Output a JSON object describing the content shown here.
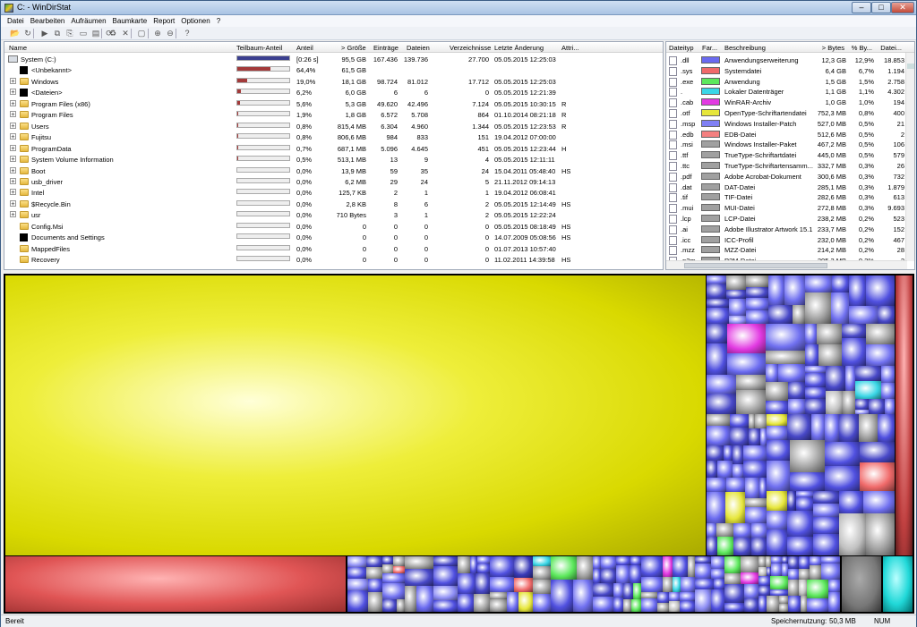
{
  "window": {
    "title": "C: - WinDirStat",
    "min": "–",
    "max": "□",
    "close": "✕"
  },
  "menu": [
    "Datei",
    "Bearbeiten",
    "Aufräumen",
    "Baumkarte",
    "Report",
    "Optionen",
    "?"
  ],
  "toolbar": [
    {
      "icon": "open-folder-icon",
      "glyph": "📂"
    },
    {
      "icon": "refresh-icon",
      "glyph": "↻"
    },
    {
      "icon": "play-icon",
      "glyph": "▶"
    },
    {
      "icon": "copy-icon",
      "glyph": "⧉"
    },
    {
      "icon": "copy-path-icon",
      "glyph": "⎘"
    },
    {
      "icon": "explorer-icon",
      "glyph": "▭"
    },
    {
      "icon": "prompt-icon",
      "glyph": "▤"
    },
    {
      "icon": "refresh-selected-icon",
      "glyph": "⟳"
    },
    {
      "icon": "recycle-icon",
      "glyph": "♻"
    },
    {
      "icon": "delete-icon",
      "glyph": "✕"
    },
    {
      "icon": "properties-icon",
      "glyph": "▢"
    },
    {
      "icon": "zoom-in-icon",
      "glyph": "⊕"
    },
    {
      "icon": "zoom-out-icon",
      "glyph": "⊖"
    },
    {
      "icon": "help-icon",
      "glyph": "?"
    }
  ],
  "tree": {
    "columns": [
      "Name",
      "Teilbaum-Anteil",
      "Anteil",
      "> Größe",
      "Einträge",
      "Dateien",
      "Verzeichnisse",
      "Letzte Änderung",
      "Attri..."
    ],
    "rows": [
      {
        "name": "System (C:)",
        "bar_text": "",
        "share": "[0:26 s]",
        "size": "95,5 GB",
        "entries": "167.436",
        "files": "139.736",
        "dirs": "27.700",
        "modified": "05.05.2015 12:25:03",
        "attr": "",
        "fill": 1.0,
        "root": true,
        "icon": "drive"
      },
      {
        "name": "<Unbekannt>",
        "share": "64,4%",
        "size": "61,5 GB",
        "entries": "",
        "files": "",
        "dirs": "",
        "modified": "",
        "attr": "",
        "fill": 0.644,
        "icon": "black"
      },
      {
        "name": "Windows",
        "share": "19,0%",
        "size": "18,1 GB",
        "entries": "98.724",
        "files": "81.012",
        "dirs": "17.712",
        "modified": "05.05.2015 12:25:03",
        "attr": "",
        "fill": 0.19,
        "icon": "folder",
        "expand": true
      },
      {
        "name": "<Dateien>",
        "share": "6,2%",
        "size": "6,0 GB",
        "entries": "6",
        "files": "6",
        "dirs": "0",
        "modified": "05.05.2015 12:21:39",
        "attr": "",
        "fill": 0.062,
        "icon": "black",
        "expand": true
      },
      {
        "name": "Program Files (x86)",
        "share": "5,6%",
        "size": "5,3 GB",
        "entries": "49.620",
        "files": "42.496",
        "dirs": "7.124",
        "modified": "05.05.2015 10:30:15",
        "attr": "R",
        "fill": 0.056,
        "icon": "folder",
        "expand": true
      },
      {
        "name": "Program Files",
        "share": "1,9%",
        "size": "1,8 GB",
        "entries": "6.572",
        "files": "5.708",
        "dirs": "864",
        "modified": "01.10.2014 08:21:18",
        "attr": "R",
        "fill": 0.019,
        "icon": "folder",
        "expand": true
      },
      {
        "name": "Users",
        "share": "0,8%",
        "size": "815,4 MB",
        "entries": "6.304",
        "files": "4.960",
        "dirs": "1.344",
        "modified": "05.05.2015 12:23:53",
        "attr": "R",
        "fill": 0.008,
        "icon": "folder",
        "expand": true
      },
      {
        "name": "Fujitsu",
        "share": "0,8%",
        "size": "806,6 MB",
        "entries": "984",
        "files": "833",
        "dirs": "151",
        "modified": "19.04.2012 07:00:00",
        "attr": "",
        "fill": 0.008,
        "icon": "folder",
        "expand": true
      },
      {
        "name": "ProgramData",
        "share": "0,7%",
        "size": "687,1 MB",
        "entries": "5.096",
        "files": "4.645",
        "dirs": "451",
        "modified": "05.05.2015 12:23:44",
        "attr": "H",
        "fill": 0.007,
        "icon": "folder",
        "expand": true
      },
      {
        "name": "System Volume Information",
        "share": "0,5%",
        "size": "513,1 MB",
        "entries": "13",
        "files": "9",
        "dirs": "4",
        "modified": "05.05.2015 12:11:11",
        "attr": "",
        "fill": 0.005,
        "icon": "folder",
        "expand": true
      },
      {
        "name": "Boot",
        "share": "0,0%",
        "size": "13,9 MB",
        "entries": "59",
        "files": "35",
        "dirs": "24",
        "modified": "15.04.2011 05:48:40",
        "attr": "HS",
        "fill": 0,
        "icon": "folder",
        "expand": true
      },
      {
        "name": "usb_driver",
        "share": "0,0%",
        "size": "6,2 MB",
        "entries": "29",
        "files": "24",
        "dirs": "5",
        "modified": "21.11.2012 09:14:13",
        "attr": "",
        "fill": 0,
        "icon": "folder",
        "expand": true
      },
      {
        "name": "Intel",
        "share": "0,0%",
        "size": "125,7 KB",
        "entries": "2",
        "files": "1",
        "dirs": "1",
        "modified": "19.04.2012 06:08:41",
        "attr": "",
        "fill": 0,
        "icon": "folder",
        "expand": true
      },
      {
        "name": "$Recycle.Bin",
        "share": "0,0%",
        "size": "2,8 KB",
        "entries": "8",
        "files": "6",
        "dirs": "2",
        "modified": "05.05.2015 12:14:49",
        "attr": "HS",
        "fill": 0,
        "icon": "folder",
        "expand": true
      },
      {
        "name": "usr",
        "share": "0,0%",
        "size": "710 Bytes",
        "entries": "3",
        "files": "1",
        "dirs": "2",
        "modified": "05.05.2015 12:22:24",
        "attr": "",
        "fill": 0,
        "icon": "folder",
        "expand": true
      },
      {
        "name": "Config.Msi",
        "share": "0,0%",
        "size": "0",
        "entries": "0",
        "files": "0",
        "dirs": "0",
        "modified": "05.05.2015 08:18:49",
        "attr": "HS",
        "fill": 0,
        "icon": "folder"
      },
      {
        "name": "Documents and Settings",
        "share": "0,0%",
        "size": "0",
        "entries": "0",
        "files": "0",
        "dirs": "0",
        "modified": "14.07.2009 05:08:56",
        "attr": "HS",
        "fill": 0,
        "icon": "black"
      },
      {
        "name": "MappedFiles",
        "share": "0,0%",
        "size": "0",
        "entries": "0",
        "files": "0",
        "dirs": "0",
        "modified": "01.07.2013 10:57:40",
        "attr": "",
        "fill": 0,
        "icon": "folder"
      },
      {
        "name": "Recovery",
        "share": "0,0%",
        "size": "0",
        "entries": "0",
        "files": "0",
        "dirs": "0",
        "modified": "11.02.2011 14:39:58",
        "attr": "HS",
        "fill": 0,
        "icon": "folder"
      }
    ]
  },
  "extensions": {
    "columns": [
      "Dateityp",
      "Far...",
      "Beschreibung",
      "> Bytes",
      "% By...",
      "Datei..."
    ],
    "rows": [
      {
        "ext": ".dll",
        "color": "#6a6af0",
        "desc": "Anwendungserweiterung",
        "bytes": "12,3 GB",
        "pct": "12,9%",
        "files": "18.853"
      },
      {
        "ext": ".sys",
        "color": "#f06a6a",
        "desc": "Systemdatei",
        "bytes": "6,4 GB",
        "pct": "6,7%",
        "files": "1.194"
      },
      {
        "ext": ".exe",
        "color": "#5ce85c",
        "desc": "Anwendung",
        "bytes": "1,5 GB",
        "pct": "1,5%",
        "files": "2.758"
      },
      {
        "ext": ".",
        "color": "#3ad6e6",
        "desc": "Lokaler Datenträger",
        "bytes": "1,1 GB",
        "pct": "1,1%",
        "files": "4.302"
      },
      {
        "ext": ".cab",
        "color": "#e23ae2",
        "desc": "WinRAR-Archiv",
        "bytes": "1,0 GB",
        "pct": "1,0%",
        "files": "194"
      },
      {
        "ext": ".otf",
        "color": "#e6e63a",
        "desc": "OpenType-Schriftartendatei",
        "bytes": "752,3 MB",
        "pct": "0,8%",
        "files": "400"
      },
      {
        "ext": ".msp",
        "color": "#8080f4",
        "desc": "Windows Installer-Patch",
        "bytes": "527,0 MB",
        "pct": "0,5%",
        "files": "21"
      },
      {
        "ext": ".edb",
        "color": "#f48080",
        "desc": "EDB-Datei",
        "bytes": "512,6 MB",
        "pct": "0,5%",
        "files": "2"
      },
      {
        "ext": ".msi",
        "color": "#a0a0a0",
        "desc": "Windows Installer-Paket",
        "bytes": "467,2 MB",
        "pct": "0,5%",
        "files": "106"
      },
      {
        "ext": ".ttf",
        "color": "#a0a0a0",
        "desc": "TrueType-Schriftartdatei",
        "bytes": "445,0 MB",
        "pct": "0,5%",
        "files": "579"
      },
      {
        "ext": ".ttc",
        "color": "#a0a0a0",
        "desc": "TrueType-Schriftartensamm...",
        "bytes": "332,7 MB",
        "pct": "0,3%",
        "files": "26"
      },
      {
        "ext": ".pdf",
        "color": "#a0a0a0",
        "desc": "Adobe Acrobat-Dokument",
        "bytes": "300,6 MB",
        "pct": "0,3%",
        "files": "732"
      },
      {
        "ext": ".dat",
        "color": "#a0a0a0",
        "desc": "DAT-Datei",
        "bytes": "285,1 MB",
        "pct": "0,3%",
        "files": "1.879"
      },
      {
        "ext": ".tif",
        "color": "#a0a0a0",
        "desc": "TIF-Datei",
        "bytes": "282,6 MB",
        "pct": "0,3%",
        "files": "613"
      },
      {
        "ext": ".mui",
        "color": "#a0a0a0",
        "desc": "MUI-Datei",
        "bytes": "272,8 MB",
        "pct": "0,3%",
        "files": "9.693"
      },
      {
        "ext": ".lcp",
        "color": "#a0a0a0",
        "desc": "LCP-Datei",
        "bytes": "238,2 MB",
        "pct": "0,2%",
        "files": "523"
      },
      {
        "ext": ".ai",
        "color": "#a0a0a0",
        "desc": "Adobe Illustrator Artwork 15.1",
        "bytes": "233,7 MB",
        "pct": "0,2%",
        "files": "152"
      },
      {
        "ext": ".icc",
        "color": "#a0a0a0",
        "desc": "ICC-Profil",
        "bytes": "232,0 MB",
        "pct": "0,2%",
        "files": "467"
      },
      {
        "ext": ".mzz",
        "color": "#a0a0a0",
        "desc": "MZZ-Datei",
        "bytes": "214,2 MB",
        "pct": "0,2%",
        "files": "28"
      },
      {
        "ext": ".p2m",
        "color": "#a0a0a0",
        "desc": "P2M-Datei",
        "bytes": "205,3 MB",
        "pct": "0,2%",
        "files": "2"
      }
    ]
  },
  "status": {
    "left": "Bereit",
    "memory_label": "Speichernutzung:",
    "memory_value": "50,3 MB",
    "num": "NUM"
  }
}
